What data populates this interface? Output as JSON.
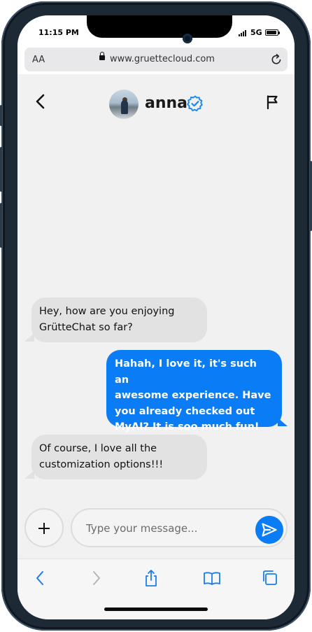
{
  "status_bar": {
    "time": "11:15 PM",
    "network": "5G"
  },
  "browser": {
    "text_size_label": "AA",
    "url": "www.gruettecloud.com"
  },
  "chat_header": {
    "contact_name": "anna"
  },
  "messages": [
    {
      "direction": "incoming",
      "lines": [
        "Hey, how are you enjoying",
        "GrütteChat so far?"
      ]
    },
    {
      "direction": "outgoing",
      "lines": [
        "Hahah, I love it, it's such an",
        "awesome experience. Have",
        "you already checked out",
        "MyAI? It is soo much fun!"
      ]
    },
    {
      "direction": "incoming",
      "lines": [
        "Of course, I love all the",
        "customization options!!!"
      ]
    }
  ],
  "composer": {
    "placeholder": "Type your message..."
  },
  "colors": {
    "accent": "#0a7cf5",
    "incoming_bubble": "#e2e2e2",
    "background": "#f1f1f1"
  },
  "icons": {
    "back": "chevron-left-icon",
    "verified": "verified-badge-icon",
    "report": "flag-icon",
    "attach": "plus-icon",
    "send": "send-icon"
  }
}
